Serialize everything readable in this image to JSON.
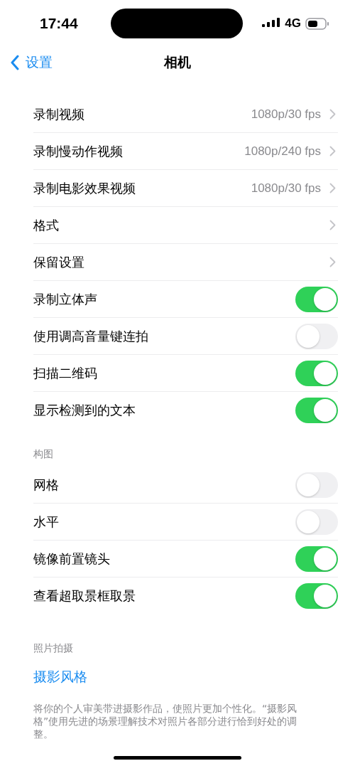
{
  "status_bar": {
    "time": "17:44",
    "network": "4G"
  },
  "nav": {
    "back": "设置",
    "title": "相机"
  },
  "groups": [
    {
      "rows": [
        {
          "kind": "link",
          "label": "录制视频",
          "value": "1080p/30 fps"
        },
        {
          "kind": "link",
          "label": "录制慢动作视频",
          "value": "1080p/240 fps"
        },
        {
          "kind": "link",
          "label": "录制电影效果视频",
          "value": "1080p/30 fps"
        },
        {
          "kind": "link",
          "label": "格式"
        },
        {
          "kind": "link",
          "label": "保留设置"
        },
        {
          "kind": "toggle",
          "label": "录制立体声",
          "on": true
        },
        {
          "kind": "toggle",
          "label": "使用调高音量键连拍",
          "on": false
        },
        {
          "kind": "toggle",
          "label": "扫描二维码",
          "on": true
        },
        {
          "kind": "toggle",
          "label": "显示检测到的文本",
          "on": true
        }
      ]
    },
    {
      "header": "构图",
      "rows": [
        {
          "kind": "toggle",
          "label": "网格",
          "on": false
        },
        {
          "kind": "toggle",
          "label": "水平",
          "on": false
        },
        {
          "kind": "toggle",
          "label": "镜像前置镜头",
          "on": true
        },
        {
          "kind": "toggle",
          "label": "查看超取景框取景",
          "on": true
        }
      ]
    }
  ],
  "photo_section": {
    "header": "照片拍摄",
    "link": "摄影风格",
    "footer": "将你的个人审美带进摄影作品，使照片更加个性化。“摄影风格”使用先进的场景理解技术对照片各部分进行恰到好处的调整。"
  }
}
